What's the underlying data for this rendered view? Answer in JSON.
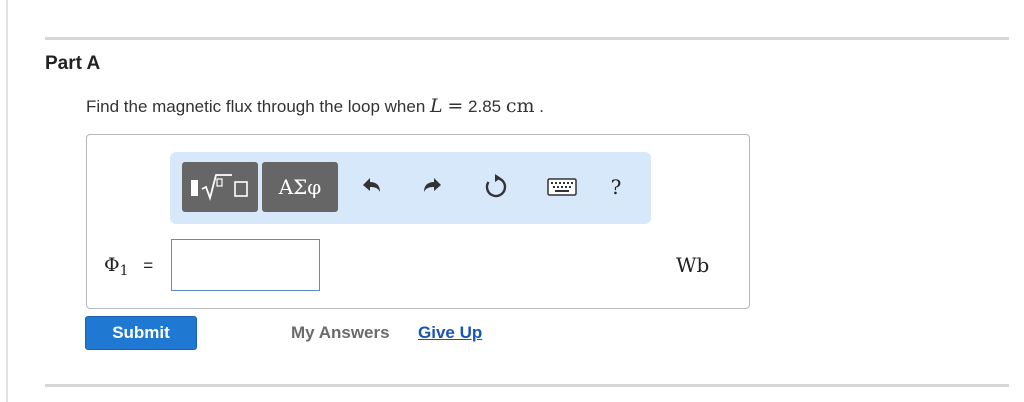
{
  "part": {
    "title": "Part A"
  },
  "question": {
    "prefix": "Find the magnetic flux through the loop when",
    "variable": "L",
    "equals": "=",
    "value": "2.85",
    "unit": "cm",
    "suffix": "."
  },
  "toolbar": {
    "templates_icon": "templates-radical-icon",
    "greek_label": "ΑΣφ",
    "undo_icon": "undo-icon",
    "redo_icon": "redo-icon",
    "reset_icon": "reset-icon",
    "keyboard_icon": "keyboard-icon",
    "help_label": "?"
  },
  "answer": {
    "symbol": "Φ",
    "subscript": "1",
    "equals": "=",
    "value": "",
    "unit": "Wb"
  },
  "actions": {
    "submit_label": "Submit",
    "my_answers_label": "My Answers",
    "give_up_label": "Give Up"
  },
  "colors": {
    "toolbar_bg": "#d7e8fa",
    "submit_bg": "#1f78d1",
    "link": "#1a55b5"
  }
}
